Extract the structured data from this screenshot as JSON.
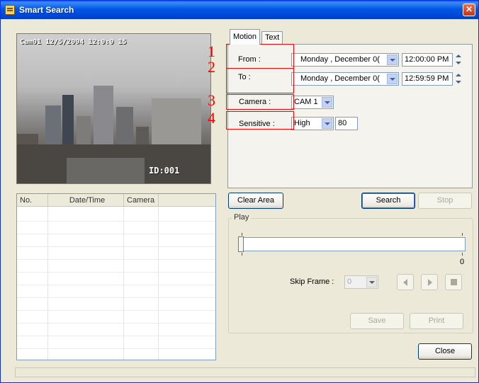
{
  "window": {
    "title": "Smart Search"
  },
  "video": {
    "osd_top": "Cam01 12/5/2004 12:0:0 15",
    "osd_bottom": "ID:001"
  },
  "list": {
    "columns": [
      "No.",
      "Date/Time",
      "Camera"
    ]
  },
  "tabs": [
    "Motion",
    "Text"
  ],
  "motion": {
    "from_label": "From :",
    "to_label": "To :",
    "camera_label": "Camera :",
    "sensitive_label": "Sensitive :",
    "from_date": "Monday   , December 0(",
    "from_time": "12:00:00 PM",
    "to_date": "Monday   , December 0(",
    "to_time": "12:59:59 PM",
    "camera_value": "CAM 1",
    "sensitivity_value": "High",
    "sensitivity_threshold": "80"
  },
  "annotations": [
    "1",
    "2",
    "3",
    "4"
  ],
  "buttons": {
    "clear_area": "Clear Area",
    "search": "Search",
    "stop": "Stop",
    "save": "Save",
    "print": "Print",
    "close": "Close"
  },
  "play": {
    "group_title": "Play",
    "slider_value_text": "0",
    "skip_frame_label": "Skip Frame :",
    "skip_frame_value": "0"
  }
}
